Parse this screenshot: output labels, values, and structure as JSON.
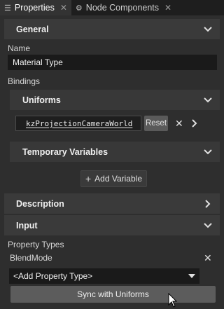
{
  "tabs": [
    {
      "label": "Properties",
      "icon": "list-icon",
      "active": true
    },
    {
      "label": "Node Components",
      "icon": "components-icon",
      "active": false
    }
  ],
  "sections": {
    "general": "General",
    "description": "Description",
    "input": "Input"
  },
  "general": {
    "name_label": "Name",
    "name_value": "Material Type",
    "bindings_label": "Bindings",
    "uniforms_header": "Uniforms",
    "uniform_value": "kzProjectionCameraWorld",
    "reset_label": "Reset",
    "temp_vars_header": "Temporary Variables",
    "add_variable_label": "Add Variable"
  },
  "input": {
    "property_types_label": "Property Types",
    "blend_mode_label": "BlendMode",
    "add_property_type": "<Add Property Type>",
    "sync_label": "Sync with Uniforms"
  },
  "colors": {
    "background": "#2e2e2e",
    "header": "#3a3a3a",
    "field": "#1a1a1a",
    "button": "#5c5c5c"
  }
}
